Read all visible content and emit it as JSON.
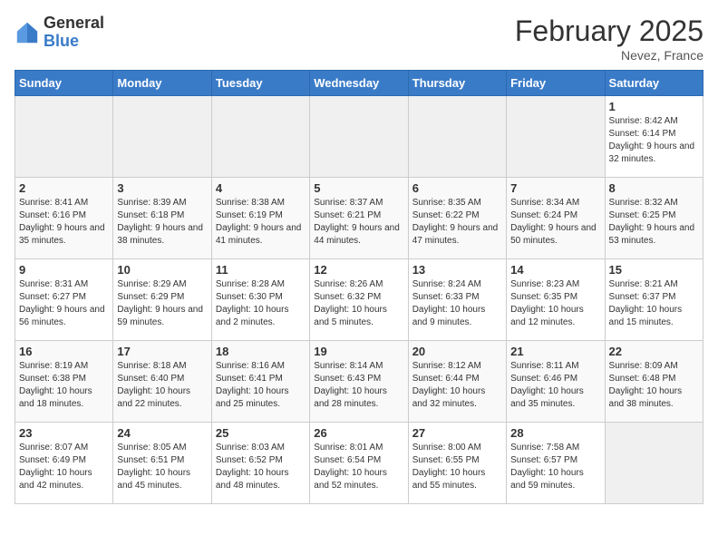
{
  "header": {
    "logo_general": "General",
    "logo_blue": "Blue",
    "title": "February 2025",
    "subtitle": "Nevez, France"
  },
  "days_of_week": [
    "Sunday",
    "Monday",
    "Tuesday",
    "Wednesday",
    "Thursday",
    "Friday",
    "Saturday"
  ],
  "weeks": [
    [
      {
        "day": "",
        "info": ""
      },
      {
        "day": "",
        "info": ""
      },
      {
        "day": "",
        "info": ""
      },
      {
        "day": "",
        "info": ""
      },
      {
        "day": "",
        "info": ""
      },
      {
        "day": "",
        "info": ""
      },
      {
        "day": "1",
        "info": "Sunrise: 8:42 AM\nSunset: 6:14 PM\nDaylight: 9 hours and 32 minutes."
      }
    ],
    [
      {
        "day": "2",
        "info": "Sunrise: 8:41 AM\nSunset: 6:16 PM\nDaylight: 9 hours and 35 minutes."
      },
      {
        "day": "3",
        "info": "Sunrise: 8:39 AM\nSunset: 6:18 PM\nDaylight: 9 hours and 38 minutes."
      },
      {
        "day": "4",
        "info": "Sunrise: 8:38 AM\nSunset: 6:19 PM\nDaylight: 9 hours and 41 minutes."
      },
      {
        "day": "5",
        "info": "Sunrise: 8:37 AM\nSunset: 6:21 PM\nDaylight: 9 hours and 44 minutes."
      },
      {
        "day": "6",
        "info": "Sunrise: 8:35 AM\nSunset: 6:22 PM\nDaylight: 9 hours and 47 minutes."
      },
      {
        "day": "7",
        "info": "Sunrise: 8:34 AM\nSunset: 6:24 PM\nDaylight: 9 hours and 50 minutes."
      },
      {
        "day": "8",
        "info": "Sunrise: 8:32 AM\nSunset: 6:25 PM\nDaylight: 9 hours and 53 minutes."
      }
    ],
    [
      {
        "day": "9",
        "info": "Sunrise: 8:31 AM\nSunset: 6:27 PM\nDaylight: 9 hours and 56 minutes."
      },
      {
        "day": "10",
        "info": "Sunrise: 8:29 AM\nSunset: 6:29 PM\nDaylight: 9 hours and 59 minutes."
      },
      {
        "day": "11",
        "info": "Sunrise: 8:28 AM\nSunset: 6:30 PM\nDaylight: 10 hours and 2 minutes."
      },
      {
        "day": "12",
        "info": "Sunrise: 8:26 AM\nSunset: 6:32 PM\nDaylight: 10 hours and 5 minutes."
      },
      {
        "day": "13",
        "info": "Sunrise: 8:24 AM\nSunset: 6:33 PM\nDaylight: 10 hours and 9 minutes."
      },
      {
        "day": "14",
        "info": "Sunrise: 8:23 AM\nSunset: 6:35 PM\nDaylight: 10 hours and 12 minutes."
      },
      {
        "day": "15",
        "info": "Sunrise: 8:21 AM\nSunset: 6:37 PM\nDaylight: 10 hours and 15 minutes."
      }
    ],
    [
      {
        "day": "16",
        "info": "Sunrise: 8:19 AM\nSunset: 6:38 PM\nDaylight: 10 hours and 18 minutes."
      },
      {
        "day": "17",
        "info": "Sunrise: 8:18 AM\nSunset: 6:40 PM\nDaylight: 10 hours and 22 minutes."
      },
      {
        "day": "18",
        "info": "Sunrise: 8:16 AM\nSunset: 6:41 PM\nDaylight: 10 hours and 25 minutes."
      },
      {
        "day": "19",
        "info": "Sunrise: 8:14 AM\nSunset: 6:43 PM\nDaylight: 10 hours and 28 minutes."
      },
      {
        "day": "20",
        "info": "Sunrise: 8:12 AM\nSunset: 6:44 PM\nDaylight: 10 hours and 32 minutes."
      },
      {
        "day": "21",
        "info": "Sunrise: 8:11 AM\nSunset: 6:46 PM\nDaylight: 10 hours and 35 minutes."
      },
      {
        "day": "22",
        "info": "Sunrise: 8:09 AM\nSunset: 6:48 PM\nDaylight: 10 hours and 38 minutes."
      }
    ],
    [
      {
        "day": "23",
        "info": "Sunrise: 8:07 AM\nSunset: 6:49 PM\nDaylight: 10 hours and 42 minutes."
      },
      {
        "day": "24",
        "info": "Sunrise: 8:05 AM\nSunset: 6:51 PM\nDaylight: 10 hours and 45 minutes."
      },
      {
        "day": "25",
        "info": "Sunrise: 8:03 AM\nSunset: 6:52 PM\nDaylight: 10 hours and 48 minutes."
      },
      {
        "day": "26",
        "info": "Sunrise: 8:01 AM\nSunset: 6:54 PM\nDaylight: 10 hours and 52 minutes."
      },
      {
        "day": "27",
        "info": "Sunrise: 8:00 AM\nSunset: 6:55 PM\nDaylight: 10 hours and 55 minutes."
      },
      {
        "day": "28",
        "info": "Sunrise: 7:58 AM\nSunset: 6:57 PM\nDaylight: 10 hours and 59 minutes."
      },
      {
        "day": "",
        "info": ""
      }
    ]
  ]
}
